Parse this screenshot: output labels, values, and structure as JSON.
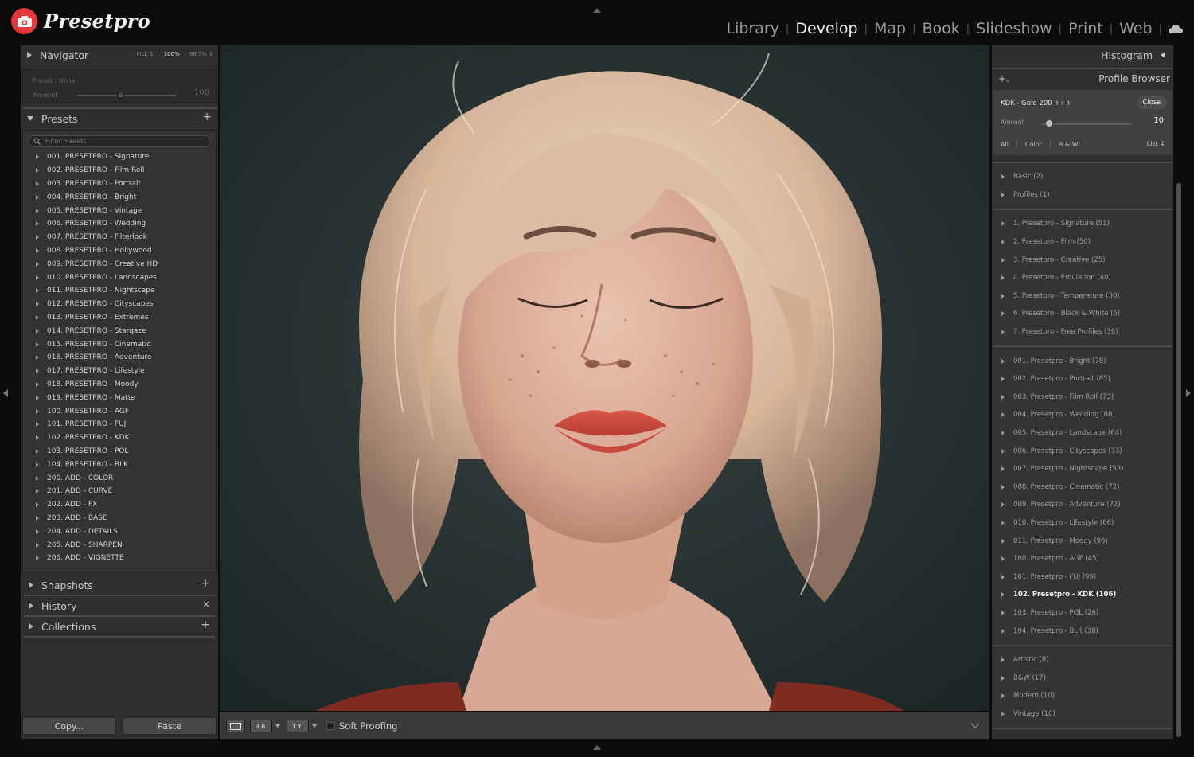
{
  "app": {
    "logo_text": "Presetpro"
  },
  "modules": [
    {
      "label": "Library",
      "active": false
    },
    {
      "label": "Develop",
      "active": true
    },
    {
      "label": "Map",
      "active": false
    },
    {
      "label": "Book",
      "active": false
    },
    {
      "label": "Slideshow",
      "active": false
    },
    {
      "label": "Print",
      "active": false
    },
    {
      "label": "Web",
      "active": false
    }
  ],
  "navigator": {
    "title": "Navigator",
    "zoom": [
      "FILL ↕",
      "100%",
      "66.7% ↕"
    ],
    "preset_label": "Preset : None",
    "amount_label": "Amount",
    "amount_value": "100"
  },
  "presets": {
    "title": "Presets",
    "filter_placeholder": "Filter Presets",
    "items": [
      "001. PRESETPRO - Signature",
      "002. PRESETPRO - Film Roll",
      "003. PRESETPRO - Portrait",
      "004. PRESETPRO - Bright",
      "005. PRESETPRO - Vintage",
      "006. PRESETPRO - Wedding",
      "007. PRESETPRO - Filterlook",
      "008. PRESETPRO - Hollywood",
      "009. PRESETPRO - Creative HD",
      "010. PRESETPRO - Landscapes",
      "011. PRESETPRO - Nightscape",
      "012. PRESETPRO - Cityscapes",
      "013. PRESETPRO - Extremes",
      "014. PRESETPRO - Stargaze",
      "015. PRESETPRO - Cinematic",
      "016. PRESETPRO - Adventure",
      "017. PRESETPRO - Lifestyle",
      "018. PRESETPRO - Moody",
      "019. PRESETPRO - Matte",
      "100. PRESETPRO - AGF",
      "101. PRESETPRO - FUJ",
      "102. PRESETPRO - KDK",
      "103. PRESETPRO - POL",
      "104. PRESETPRO - BLK",
      "200. ADD - COLOR",
      "201. ADD - CURVE",
      "202. ADD - FX",
      "203. ADD - BASE",
      "204. ADD - DETAILS",
      "205. ADD - SHARPEN",
      "206. ADD - VIGNETTE"
    ]
  },
  "left_sections": {
    "snapshots": "Snapshots",
    "history": "History",
    "collections": "Collections"
  },
  "left_buttons": {
    "copy": "Copy...",
    "paste": "Paste"
  },
  "toolbar": {
    "soft_proofing": "Soft Proofing"
  },
  "right": {
    "histogram": "Histogram",
    "profile_browser": "Profile Browser",
    "profile_name": "KDK - Gold 200 +++",
    "close": "Close",
    "amount_label": "Amount",
    "amount_value": "10",
    "categories": [
      "All",
      "Color",
      "B & W"
    ],
    "list_label": "List ↕",
    "groups": [
      [
        "Basic (2)",
        "Profiles (1)"
      ],
      [
        "1. Presetpro - Signature (51)",
        "2. Presetpro - Film (50)",
        "3. Presetpro - Creative (25)",
        "4. Presetpro - Emulation (40)",
        "5. Presetpro - Temperature (30)",
        "6. Presetpro - Black & White (5)",
        "7. Presetpro - Free Profiles (36)"
      ],
      [
        "001. Presetpro - Bright (78)",
        "002. Presetpro - Portrait (85)",
        "003. Presetpro - Film Roll (73)",
        "004. Presetpro - Wedding (80)",
        "005. Presetpro - Landscape (64)",
        "006. Presetpro - Cityscapes (73)",
        "007. Presetpro - Nightscape (53)",
        "008. Presetpro - Cinematic (72)",
        "009. Presetpro - Adventure (72)",
        "010. Presetpro - Lifestyle (66)",
        "011. Presetpro - Moody (96)",
        "100. Presetpro - AGF (45)",
        "101. Presetpro - FUJ (99)",
        "102. Presetpro - KDK (106)",
        "103. Presetpro - POL (26)",
        "104. Presetpro - BLK (30)"
      ],
      [
        "Artistic (8)",
        "B&W (17)",
        "Modern (10)",
        "Vintage (10)"
      ]
    ],
    "selected": "102. Presetpro - KDK (106)"
  },
  "colors": {
    "logo_red": "#e4373a",
    "panel": "#2f2f2f",
    "backdrop": "#253131"
  },
  "icons": [
    "camera-icon",
    "cloud-icon",
    "search-icon",
    "plus-icon",
    "close-icon"
  ]
}
